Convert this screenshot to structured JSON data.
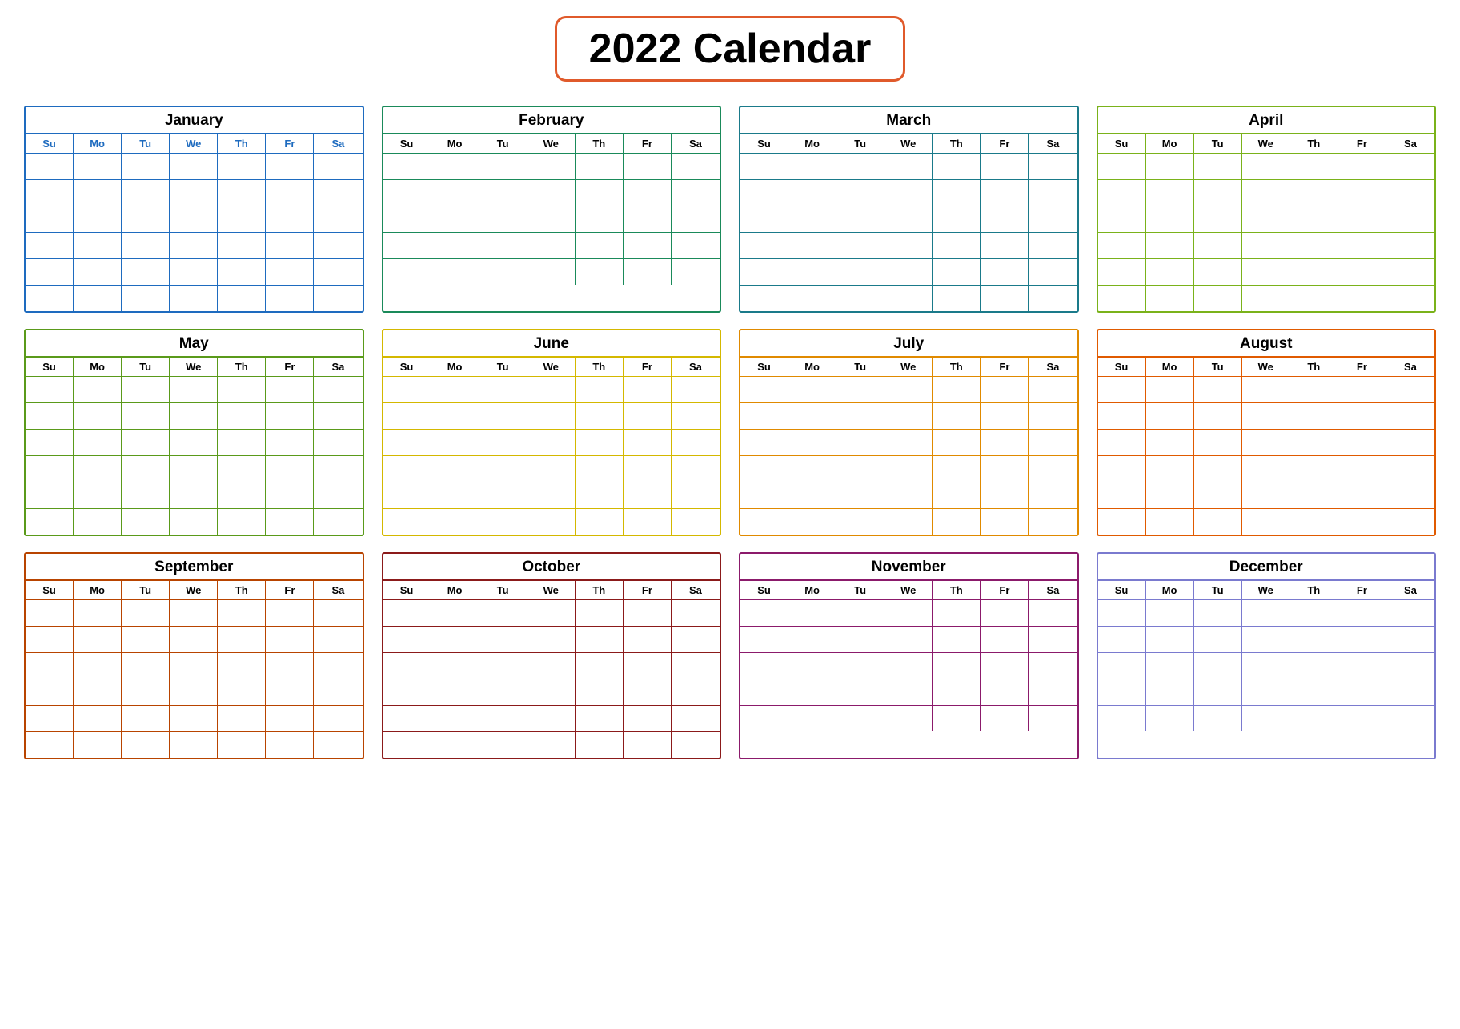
{
  "title": "2022 Calendar",
  "days": [
    "Su",
    "Mo",
    "Tu",
    "We",
    "Th",
    "Fr",
    "Sa"
  ],
  "months": [
    {
      "id": "jan",
      "name": "January",
      "rows": 6,
      "cssClass": "month-jan"
    },
    {
      "id": "feb",
      "name": "February",
      "rows": 5,
      "cssClass": "month-feb"
    },
    {
      "id": "mar",
      "name": "March",
      "rows": 6,
      "cssClass": "month-mar"
    },
    {
      "id": "apr",
      "name": "April",
      "rows": 6,
      "cssClass": "month-apr"
    },
    {
      "id": "may",
      "name": "May",
      "rows": 6,
      "cssClass": "month-may"
    },
    {
      "id": "jun",
      "name": "June",
      "rows": 6,
      "cssClass": "month-jun"
    },
    {
      "id": "jul",
      "name": "July",
      "rows": 6,
      "cssClass": "month-jul"
    },
    {
      "id": "aug",
      "name": "August",
      "rows": 6,
      "cssClass": "month-aug"
    },
    {
      "id": "sep",
      "name": "September",
      "rows": 6,
      "cssClass": "month-sep"
    },
    {
      "id": "oct",
      "name": "October",
      "rows": 6,
      "cssClass": "month-oct"
    },
    {
      "id": "nov",
      "name": "November",
      "rows": 5,
      "cssClass": "month-nov"
    },
    {
      "id": "dec",
      "name": "December",
      "rows": 5,
      "cssClass": "month-dec"
    }
  ]
}
